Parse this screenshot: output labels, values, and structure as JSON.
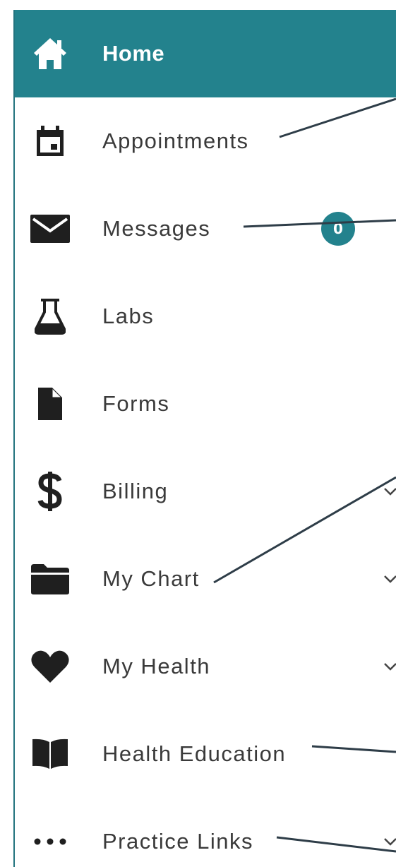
{
  "colors": {
    "accent": "#23828d",
    "text": "#3a3a3a",
    "icon": "#1f1f1f",
    "annotation_line": "#2e3d48"
  },
  "nav": {
    "items": [
      {
        "label": "Home",
        "icon": "home-icon",
        "active": true
      },
      {
        "label": "Appointments",
        "icon": "calendar-icon"
      },
      {
        "label": "Messages",
        "icon": "envelope-icon",
        "badge": "0"
      },
      {
        "label": "Labs",
        "icon": "flask-icon"
      },
      {
        "label": "Forms",
        "icon": "file-icon"
      },
      {
        "label": "Billing",
        "icon": "dollar-icon",
        "expandable": true
      },
      {
        "label": "My Chart",
        "icon": "folder-icon",
        "expandable": true
      },
      {
        "label": "My Health",
        "icon": "heart-icon",
        "expandable": true
      },
      {
        "label": "Health Education",
        "icon": "book-icon"
      },
      {
        "label": "Practice Links",
        "icon": "ellipsis-icon",
        "expandable": true
      }
    ]
  }
}
